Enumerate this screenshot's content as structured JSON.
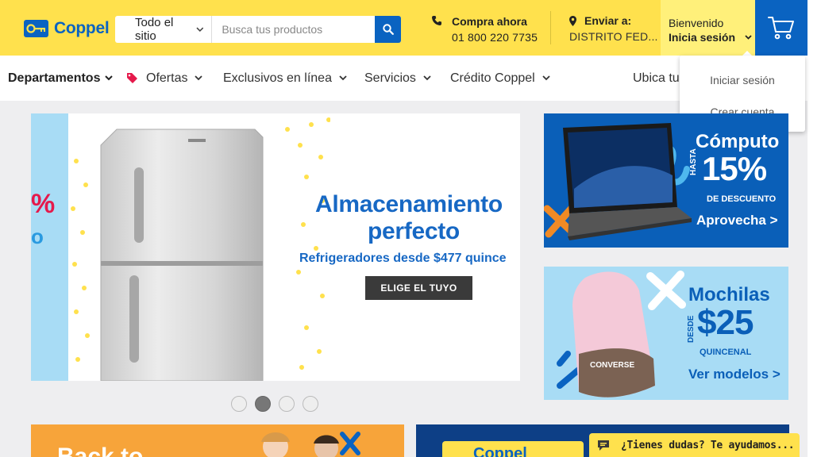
{
  "header": {
    "logo_text": "Coppel",
    "search": {
      "category": "Todo el sitio",
      "placeholder": "Busca tus productos"
    },
    "phone": {
      "title": "Compra ahora",
      "number": "01 800 220 7735"
    },
    "shipping": {
      "title": "Enviar a:",
      "location": "DISTRITO FED..."
    },
    "account": {
      "greeting": "Bienvenido",
      "action": "Inicia sesión"
    }
  },
  "nav": {
    "items": [
      {
        "label": "Departamentos"
      },
      {
        "label": "Ofertas"
      },
      {
        "label": "Exclusivos en línea"
      },
      {
        "label": "Servicios"
      },
      {
        "label": "Crédito Coppel"
      },
      {
        "label": "Ubica tu"
      }
    ]
  },
  "account_dropdown": {
    "items": [
      "Iniciar sesión",
      "Crear cuenta"
    ]
  },
  "hero": {
    "title_line1": "Almacenamiento",
    "title_line2": "perfecto",
    "subtitle": "Refrigeradores desde $477 quince",
    "cta": "ELIGE EL TUYO",
    "left_pct": "%",
    "left_o": "o",
    "slides": 4,
    "active_slide": 2
  },
  "promo_computo": {
    "title": "Cómputo",
    "prefix": "HASTA",
    "percent": "15%",
    "note": "DE DESCUENTO",
    "cta": "Aprovecha >"
  },
  "promo_mochilas": {
    "title": "Mochilas",
    "prefix": "DESDE",
    "price": "$25",
    "note": "QUINCENAL",
    "brand": "CONVERSE",
    "cta": "Ver modelos >"
  },
  "bottom_left": {
    "text": "Back to"
  },
  "bottom_right": {
    "text": "Coppel"
  },
  "chat": {
    "text": "¿Tienes dudas? Te ayudamos..."
  },
  "colors": {
    "brand_yellow": "#ffe14d",
    "brand_blue": "#0a63c1",
    "offer_red": "#e5194b"
  }
}
